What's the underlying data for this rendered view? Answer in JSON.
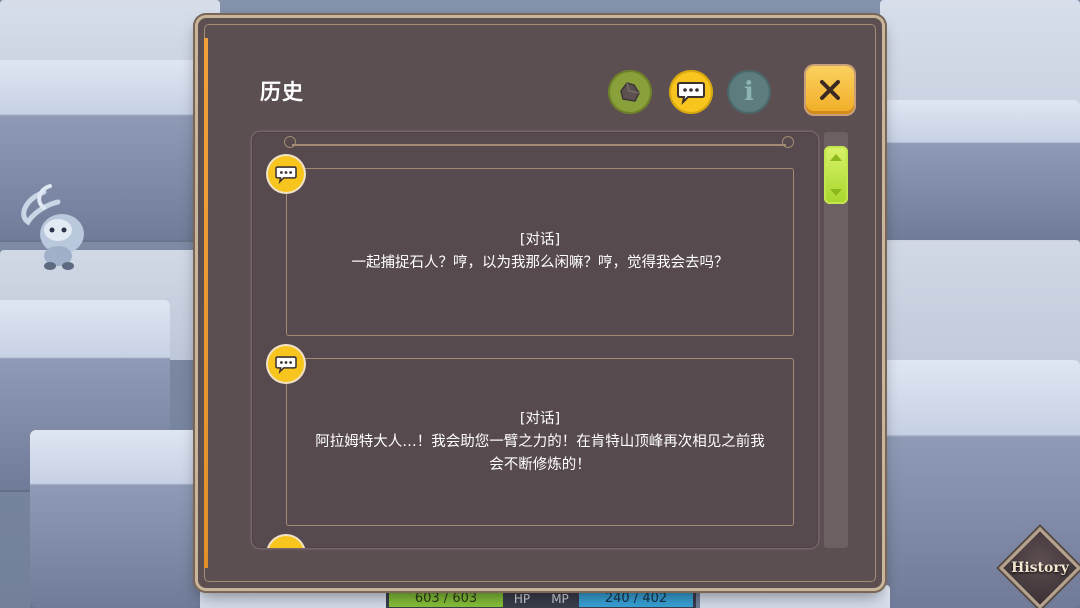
{
  "history_panel": {
    "title": "历史",
    "tabs": [
      {
        "name": "rock",
        "icon": "rock-icon",
        "color": "#8aa03a"
      },
      {
        "name": "dialogue",
        "icon": "chat-bubble-icon",
        "color": "#f7c51e",
        "active": true
      },
      {
        "name": "info",
        "icon": "info-icon",
        "glyph": "i",
        "color": "#5c7c7e"
      }
    ],
    "entries": [
      {
        "tag": "[对话]",
        "lines": [
          "一起捕捉石人？哼，以为我那么闲嘛？哼，觉得我会去吗？"
        ]
      },
      {
        "tag": "[对话]",
        "lines": [
          "阿拉姆特大人…！我会助您一臂之力的！在肯特山顶峰再次相见之前我",
          "会不断修炼的！"
        ]
      }
    ]
  },
  "status_bar": {
    "hp_value": "603 / 603",
    "hp_label": "HP",
    "mp_label": "MP",
    "mp_value": "240 / 402"
  },
  "history_button": {
    "label": "History"
  },
  "colors": {
    "panel_bg": "#5b4f52",
    "accent_gold": "#f7c51e",
    "scroll_green": "#a7d62b",
    "hp_green": "#86c23a",
    "mp_blue": "#39a3d9"
  }
}
